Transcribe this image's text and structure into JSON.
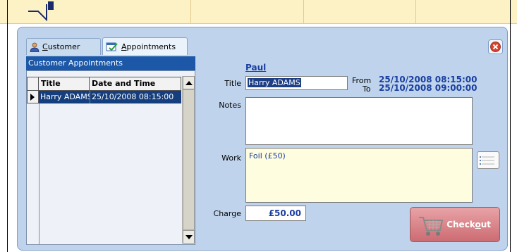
{
  "background": {
    "accent": "#fdf2c6"
  },
  "dialog": {
    "tabs": [
      {
        "label_pre": "",
        "label_u": "C",
        "label_post": "ustomer",
        "icon": "customer-icon",
        "active": false
      },
      {
        "label_pre": "",
        "label_u": "A",
        "label_post": "ppointments",
        "icon": "appointments-icon",
        "active": true
      }
    ],
    "close_icon": "close-icon"
  },
  "appointments_list": {
    "header": "Customer Appointments",
    "columns": [
      "Title",
      "Date and Time"
    ],
    "rows": [
      {
        "title": "Harry ADAMS",
        "datetime": "25/10/2008 08:15:00",
        "selected": true
      }
    ]
  },
  "details": {
    "customer_name": "Paul",
    "title_label": "Title",
    "title_value": "Harry ADAMS",
    "from_label": "From",
    "from_value": "25/10/2008 08:15:00",
    "to_label": "To",
    "to_value": "25/10/2008 09:00:00",
    "notes_label": "Notes",
    "notes_value": "",
    "work_label": "Work",
    "work_value": "Foil (£50)",
    "charge_label": "Charge",
    "charge_value": "£50.00"
  },
  "checkout": {
    "label_pre": "Check",
    "label_u": "o",
    "label_post": "ut"
  },
  "colors": {
    "link": "#1a3ea0",
    "selection": "#153e7e",
    "dialog_bg": "#bfd4ec",
    "checkout": "#cc6b72"
  }
}
